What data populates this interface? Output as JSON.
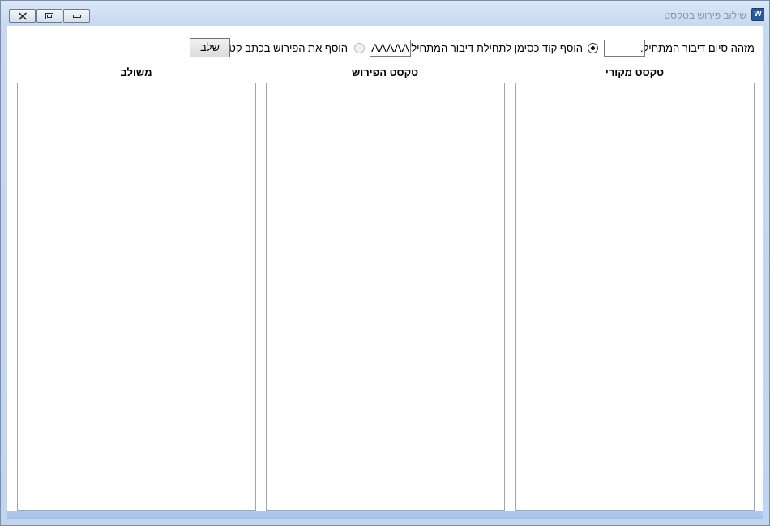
{
  "window": {
    "title": "שילוב פירוש בטקסט",
    "app_icon": "word-icon",
    "controls": [
      "close-icon",
      "restore-icon",
      "minimize-icon"
    ]
  },
  "toolbar": {
    "end_marker_label": "מזהה סיום דיבור המתחיל:",
    "end_marker_value": ".",
    "prefix_code_label": "הוסף קוד כסימן לתחילת דיבור המתחיל:",
    "prefix_code_checked": true,
    "prefix_code_value": "AAAAA",
    "small_font_label": "הוסף את הפירוש בכתב קטן",
    "small_font_checked": false,
    "merge_button": "שלב"
  },
  "columns": [
    {
      "header": "טקסט מקורי",
      "content": ""
    },
    {
      "header": "טקסט הפירוש",
      "content": ""
    },
    {
      "header": "משולב",
      "content": ""
    }
  ]
}
